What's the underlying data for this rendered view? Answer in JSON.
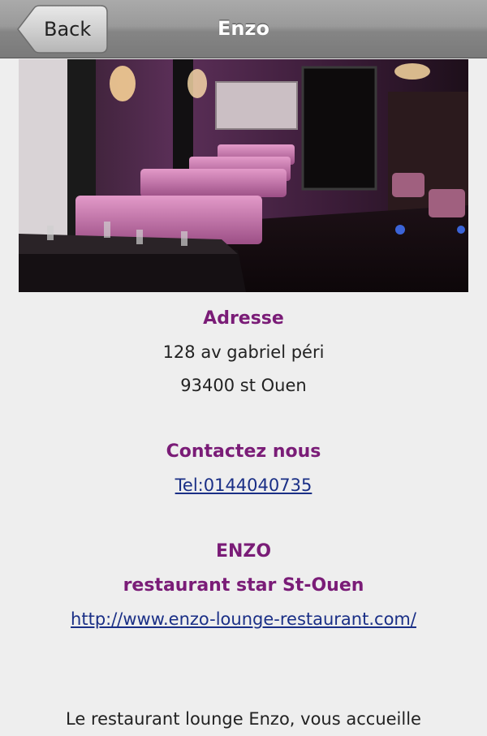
{
  "header": {
    "back_label": "Back",
    "title": "Enzo"
  },
  "photo": {
    "description_icon": "restaurant-interior-photo"
  },
  "address": {
    "heading": "Adresse",
    "street": "128 av gabriel péri",
    "city": "93400 st Ouen"
  },
  "contact": {
    "heading": "Contactez nous",
    "phone_link": "Tel:0144040735"
  },
  "about": {
    "name": "ENZO",
    "tagline": "restaurant star St-Ouen",
    "website": "http://www.enzo-lounge-restaurant.com/",
    "intro": "Le restaurant lounge Enzo, vous accueille"
  },
  "colors": {
    "heading": "#7a1c77",
    "link": "#1a2f86",
    "background": "#eeeeee"
  }
}
